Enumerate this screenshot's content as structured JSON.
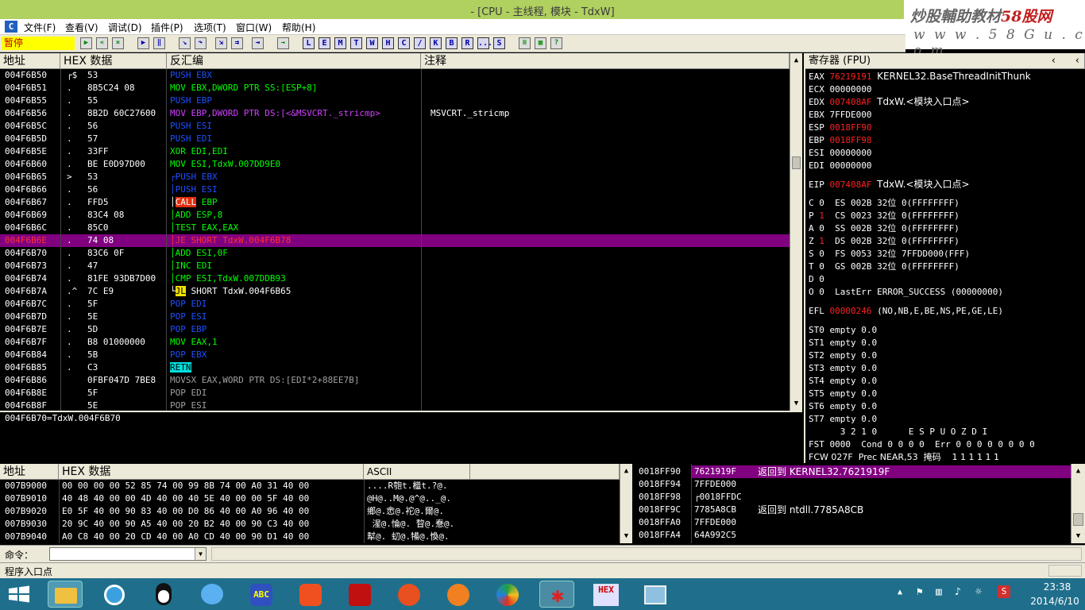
{
  "window": {
    "title": "- [CPU - 主线程, 模块 - TdxW]"
  },
  "watermark": {
    "line1a": "炒股輔助教材",
    "line1b": "58股网",
    "line2": "w w w . 5 8 G u . c o m"
  },
  "menu": {
    "items": [
      "文件(F)",
      "查看(V)",
      "调试(D)",
      "插件(P)",
      "选项(T)",
      "窗口(W)",
      "帮助(H)"
    ]
  },
  "toolbar": {
    "status": "暂停",
    "letters": [
      "L",
      "E",
      "M",
      "T",
      "W",
      "H",
      "C",
      "/",
      "K",
      "B",
      "R",
      "...",
      "S"
    ]
  },
  "cpu": {
    "headers": {
      "addr": "地址",
      "hex": "HEX 数据",
      "dis": "反汇编",
      "cmt": "注释"
    },
    "rows": [
      {
        "addr": "004F6B50",
        "mark": "┌$",
        "hex": "53",
        "dis": "PUSH EBX",
        "cls": "push",
        "cmt": ""
      },
      {
        "addr": "004F6B51",
        "mark": ".",
        "hex": "8B5C24 08",
        "dis": "MOV EBX,DWORD PTR SS:[ESP+8]",
        "cls": "mov",
        "cmt": ""
      },
      {
        "addr": "004F6B55",
        "mark": ".",
        "hex": "55",
        "dis": "PUSH EBP",
        "cls": "push",
        "cmt": ""
      },
      {
        "addr": "004F6B56",
        "mark": ".",
        "hex": "8B2D 60C27600",
        "dis": "MOV EBP,DWORD PTR DS:[<&MSVCRT._stricmp>",
        "cls": "movds",
        "cmt": "MSVCRT._stricmp"
      },
      {
        "addr": "004F6B5C",
        "mark": ".",
        "hex": "56",
        "dis": "PUSH ESI",
        "cls": "push",
        "cmt": ""
      },
      {
        "addr": "004F6B5D",
        "mark": ".",
        "hex": "57",
        "dis": "PUSH EDI",
        "cls": "push",
        "cmt": ""
      },
      {
        "addr": "004F6B5E",
        "mark": ".",
        "hex": "33FF",
        "dis": "XOR EDI,EDI",
        "cls": "mov",
        "cmt": ""
      },
      {
        "addr": "004F6B60",
        "mark": ".",
        "hex": "BE E0D97D00",
        "dis": "MOV ESI,TdxW.007DD9E0",
        "cls": "mov",
        "cmt": ""
      },
      {
        "addr": "004F6B65",
        "mark": ">",
        "hex": "53",
        "dis": "┌PUSH EBX",
        "cls": "push2",
        "cmt": ""
      },
      {
        "addr": "004F6B66",
        "mark": ".",
        "hex": "56",
        "dis": "│PUSH ESI",
        "cls": "push2",
        "cmt": ""
      },
      {
        "addr": "004F6B67",
        "mark": ".",
        "hex": "FFD5",
        "dis": "│CALL EBP",
        "cls": "call",
        "cmt": ""
      },
      {
        "addr": "004F6B69",
        "mark": ".",
        "hex": "83C4 08",
        "dis": "│ADD ESP,8",
        "cls": "add",
        "cmt": ""
      },
      {
        "addr": "004F6B6C",
        "mark": ".",
        "hex": "85C0",
        "dis": "│TEST EAX,EAX",
        "cls": "add",
        "cmt": ""
      },
      {
        "addr": "004F6B6E",
        "mark": ".",
        "hex": "74 08",
        "dis": "│JE SHORT TdxW.004F6B78",
        "cls": "sel",
        "cmt": ""
      },
      {
        "addr": "004F6B70",
        "mark": ".",
        "hex": "83C6 0F",
        "dis": "│ADD ESI,0F",
        "cls": "add",
        "cmt": ""
      },
      {
        "addr": "004F6B73",
        "mark": ".",
        "hex": "47",
        "dis": "│INC EDI",
        "cls": "add",
        "cmt": ""
      },
      {
        "addr": "004F6B74",
        "mark": ".",
        "hex": "81FE 93DB7D00",
        "dis": "│CMP ESI,TdxW.007DDB93",
        "cls": "add",
        "cmt": ""
      },
      {
        "addr": "004F6B7A",
        "mark": ".^",
        "hex": "7C E9",
        "dis": "└JL SHORT TdxW.004F6B65",
        "cls": "jl",
        "cmt": ""
      },
      {
        "addr": "004F6B7C",
        "mark": ".",
        "hex": "5F",
        "dis": "POP EDI",
        "cls": "push",
        "cmt": ""
      },
      {
        "addr": "004F6B7D",
        "mark": ".",
        "hex": "5E",
        "dis": "POP ESI",
        "cls": "push",
        "cmt": ""
      },
      {
        "addr": "004F6B7E",
        "mark": ".",
        "hex": "5D",
        "dis": "POP EBP",
        "cls": "push",
        "cmt": ""
      },
      {
        "addr": "004F6B7F",
        "mark": ".",
        "hex": "B8 01000000",
        "dis": "MOV EAX,1",
        "cls": "mov",
        "cmt": ""
      },
      {
        "addr": "004F6B84",
        "mark": ".",
        "hex": "5B",
        "dis": "POP EBX",
        "cls": "push",
        "cmt": ""
      },
      {
        "addr": "004F6B85",
        "mark": ".",
        "hex": "C3",
        "dis": "RETN",
        "cls": "retn",
        "cmt": ""
      },
      {
        "addr": "004F6B86",
        "mark": "",
        "hex": "0FBF047D 7BE8",
        "dis": "MOVSX EAX,WORD PTR DS:[EDI*2+88EE7B]",
        "cls": "gray",
        "cmt": ""
      },
      {
        "addr": "004F6B8E",
        "mark": "",
        "hex": "5F",
        "dis": "POP EDI",
        "cls": "gray",
        "cmt": ""
      },
      {
        "addr": "004F6B8F",
        "mark": "",
        "hex": "5E",
        "dis": "POP ESI",
        "cls": "gray",
        "cmt": ""
      }
    ],
    "info": "004F6B70=TdxW.004F6B70"
  },
  "registers": {
    "title": "寄存器 (FPU)",
    "gp": [
      {
        "n": "EAX",
        "v": "76219191",
        "red": true,
        "c": "KERNEL32.BaseThreadInitThunk"
      },
      {
        "n": "ECX",
        "v": "00000000",
        "red": false,
        "c": ""
      },
      {
        "n": "EDX",
        "v": "007408AF",
        "red": true,
        "c": "TdxW.<模块入口点>"
      },
      {
        "n": "EBX",
        "v": "7FFDE000",
        "red": false,
        "c": ""
      },
      {
        "n": "ESP",
        "v": "0018FF90",
        "red": true,
        "c": ""
      },
      {
        "n": "EBP",
        "v": "0018FF98",
        "red": true,
        "c": ""
      },
      {
        "n": "ESI",
        "v": "00000000",
        "red": false,
        "c": ""
      },
      {
        "n": "EDI",
        "v": "00000000",
        "red": false,
        "c": ""
      }
    ],
    "eip": {
      "n": "EIP",
      "v": "007408AF",
      "c": "TdxW.<模块入口点>"
    },
    "flags": [
      {
        "f": "C",
        "b": "0",
        "red": false,
        "s": "ES 002B 32位 0(FFFFFFFF)"
      },
      {
        "f": "P",
        "b": "1",
        "red": true,
        "s": "CS 0023 32位 0(FFFFFFFF)"
      },
      {
        "f": "A",
        "b": "0",
        "red": false,
        "s": "SS 002B 32位 0(FFFFFFFF)"
      },
      {
        "f": "Z",
        "b": "1",
        "red": true,
        "s": "DS 002B 32位 0(FFFFFFFF)"
      },
      {
        "f": "S",
        "b": "0",
        "red": false,
        "s": "FS 0053 32位 7FFDD000(FFF)"
      },
      {
        "f": "T",
        "b": "0",
        "red": false,
        "s": "GS 002B 32位 0(FFFFFFFF)"
      },
      {
        "f": "D",
        "b": "0",
        "red": false,
        "s": ""
      },
      {
        "f": "O",
        "b": "0",
        "red": false,
        "s": "LastErr ERROR_SUCCESS (00000000)"
      }
    ],
    "efl": {
      "n": "EFL",
      "v": "00000246",
      "c": "(NO,NB,E,BE,NS,PE,GE,LE)"
    },
    "st": [
      "ST0 empty 0.0",
      "ST1 empty 0.0",
      "ST2 empty 0.0",
      "ST3 empty 0.0",
      "ST4 empty 0.0",
      "ST5 empty 0.0",
      "ST6 empty 0.0",
      "ST7 empty 0.0"
    ],
    "fpu1": "      3 2 1 0      E S P U O Z D I",
    "fpu2": "FST 0000  Cond 0 0 0 0  Err 0 0 0 0 0 0 0 0",
    "fpu3": "FCW 027F  Prec NEAR,53  掩码    1 1 1 1 1 1"
  },
  "dump": {
    "headers": {
      "addr": "地址",
      "hex": "HEX 数据",
      "ascii": "ASCII"
    },
    "rows": [
      {
        "addr": "007B9000",
        "hex": "00 00 00 00 52 85 74 00 99 8B 74 00 A0 31 40 00",
        "ascii": "....R匏t.檵t.?@."
      },
      {
        "addr": "007B9010",
        "hex": "40 48 40 00 00 4D 40 00 40 5E 40 00 00 5F 40 00",
        "ascii": "@H@..M@.@^@.._@."
      },
      {
        "addr": "007B9020",
        "hex": "E0 5F 40 00 90 83 40 00 D0 86 40 00 A0 96 40 00",
        "ascii": "鄉@.悆@.袉@.爾@."
      },
      {
        "addr": "007B9030",
        "hex": "20 9C 40 00 90 A5 40 00 20 B2 40 00 90 C3 40 00",
        "ascii": " 湦@.惀@. 睝@.惷@."
      },
      {
        "addr": "007B9040",
        "hex": "A0 C8 40 00 20 CD 40 00 A0 CD 40 00 90 D1 40 00",
        "ascii": "犎@. 虭@.犕@.愌@."
      }
    ]
  },
  "stack": {
    "rows": [
      {
        "addr": "0018FF90",
        "val": "7621919F",
        "cmt": "返回到 KERNEL32.7621919F",
        "sel": true
      },
      {
        "addr": "0018FF94",
        "val": "7FFDE000",
        "cmt": "",
        "sel": false
      },
      {
        "addr": "0018FF98",
        "val": "┌0018FFDC",
        "cmt": "",
        "sel": false
      },
      {
        "addr": "0018FF9C",
        "val": "7785A8CB",
        "cmt": "返回到 ntdll.7785A8CB",
        "sel": false
      },
      {
        "addr": "0018FFA0",
        "val": "7FFDE000",
        "cmt": "",
        "sel": false
      },
      {
        "addr": "0018FFA4",
        "val": "64A992C5",
        "cmt": "",
        "sel": false
      }
    ]
  },
  "command": {
    "label": "命令：",
    "value": ""
  },
  "status": {
    "text": "程序入口点"
  },
  "taskbar": {
    "time": "23:38",
    "date": "2014/6/10"
  }
}
